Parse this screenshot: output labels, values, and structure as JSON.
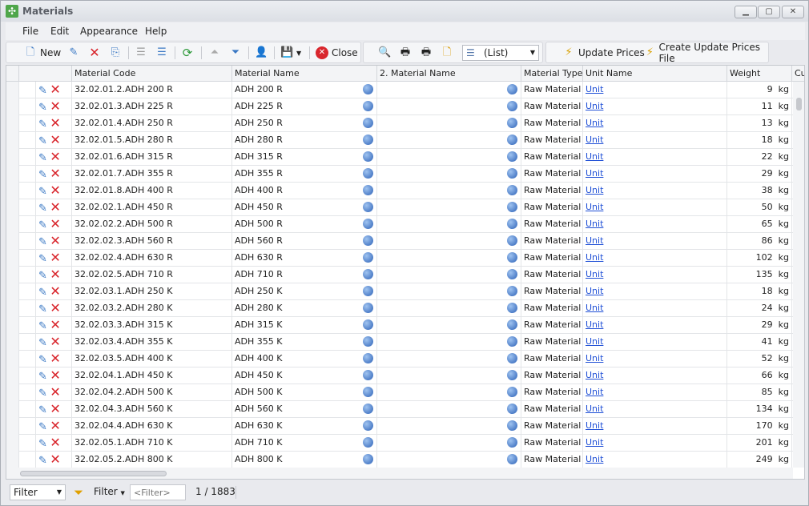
{
  "window": {
    "title": "Materials",
    "icon": "recycle-icon"
  },
  "menu": [
    "File",
    "Edit",
    "Appearance",
    "Help"
  ],
  "toolbar": {
    "new": "New",
    "close": "Close",
    "view_combo": "(List)",
    "update_prices": "Update Prices",
    "create_update_prices_file": "Create Update Prices File"
  },
  "columns": [
    "Material Code",
    "Material Name",
    "2. Material Name",
    "Material Type",
    "Unit Name",
    "Weight",
    "Cu"
  ],
  "rows": [
    [
      "32.02.01.2.ADH 200 R",
      "ADH 200 R",
      "",
      "Raw Material",
      "Unit",
      "9",
      "kg"
    ],
    [
      "32.02.01.3.ADH 225 R",
      "ADH 225 R",
      "",
      "Raw Material",
      "Unit",
      "11",
      "kg"
    ],
    [
      "32.02.01.4.ADH 250 R",
      "ADH 250 R",
      "",
      "Raw Material",
      "Unit",
      "13",
      "kg"
    ],
    [
      "32.02.01.5.ADH 280 R",
      "ADH 280 R",
      "",
      "Raw Material",
      "Unit",
      "18",
      "kg"
    ],
    [
      "32.02.01.6.ADH 315 R",
      "ADH 315 R",
      "",
      "Raw Material",
      "Unit",
      "22",
      "kg"
    ],
    [
      "32.02.01.7.ADH 355 R",
      "ADH 355 R",
      "",
      "Raw Material",
      "Unit",
      "29",
      "kg"
    ],
    [
      "32.02.01.8.ADH 400 R",
      "ADH 400 R",
      "",
      "Raw Material",
      "Unit",
      "38",
      "kg"
    ],
    [
      "32.02.02.1.ADH 450 R",
      "ADH 450 R",
      "",
      "Raw Material",
      "Unit",
      "50",
      "kg"
    ],
    [
      "32.02.02.2.ADH 500 R",
      "ADH 500 R",
      "",
      "Raw Material",
      "Unit",
      "65",
      "kg"
    ],
    [
      "32.02.02.3.ADH 560 R",
      "ADH 560 R",
      "",
      "Raw Material",
      "Unit",
      "86",
      "kg"
    ],
    [
      "32.02.02.4.ADH 630 R",
      "ADH 630 R",
      "",
      "Raw Material",
      "Unit",
      "102",
      "kg"
    ],
    [
      "32.02.02.5.ADH 710 R",
      "ADH 710 R",
      "",
      "Raw Material",
      "Unit",
      "135",
      "kg"
    ],
    [
      "32.02.03.1.ADH 250 K",
      "ADH 250 K",
      "",
      "Raw Material",
      "Unit",
      "18",
      "kg"
    ],
    [
      "32.02.03.2.ADH 280 K",
      "ADH 280 K",
      "",
      "Raw Material",
      "Unit",
      "24",
      "kg"
    ],
    [
      "32.02.03.3.ADH 315 K",
      "ADH 315 K",
      "",
      "Raw Material",
      "Unit",
      "29",
      "kg"
    ],
    [
      "32.02.03.4.ADH 355 K",
      "ADH 355 K",
      "",
      "Raw Material",
      "Unit",
      "41",
      "kg"
    ],
    [
      "32.02.03.5.ADH 400 K",
      "ADH 400 K",
      "",
      "Raw Material",
      "Unit",
      "52",
      "kg"
    ],
    [
      "32.02.04.1.ADH 450 K",
      "ADH 450 K",
      "",
      "Raw Material",
      "Unit",
      "66",
      "kg"
    ],
    [
      "32.02.04.2.ADH 500 K",
      "ADH 500 K",
      "",
      "Raw Material",
      "Unit",
      "85",
      "kg"
    ],
    [
      "32.02.04.3.ADH 560 K",
      "ADH 560 K",
      "",
      "Raw Material",
      "Unit",
      "134",
      "kg"
    ],
    [
      "32.02.04.4.ADH 630 K",
      "ADH 630 K",
      "",
      "Raw Material",
      "Unit",
      "170",
      "kg"
    ],
    [
      "32.02.05.1.ADH 710 K",
      "ADH 710 K",
      "",
      "Raw Material",
      "Unit",
      "201",
      "kg"
    ],
    [
      "32.02.05.2.ADH 800 K",
      "ADH 800 K",
      "",
      "Raw Material",
      "Unit",
      "249",
      "kg"
    ]
  ],
  "status": {
    "filter_combo": "Filter",
    "filter_menu": "Filter",
    "filter_placeholder": "<Filter>",
    "record_count": "1 / 1883"
  }
}
